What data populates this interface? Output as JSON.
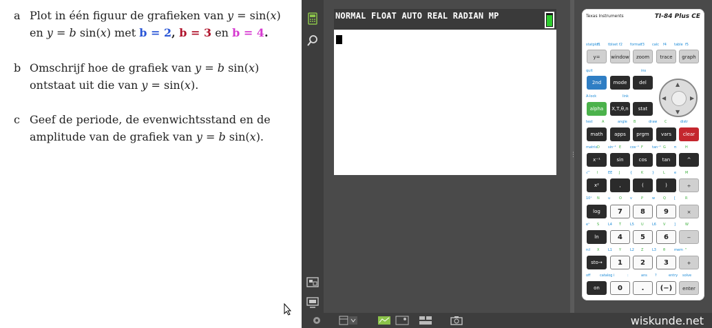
{
  "questions": [
    {
      "letter": "a",
      "line1_pre": "Plot in één figuur de grafieken van ",
      "line1_math": "y",
      "line1_mid": " = sin(",
      "line1_x": "x",
      "line1_end": ")",
      "line2_pre": "en ",
      "line2_math": "y",
      "line2_mid": " = ",
      "line2_b": "b",
      "line2_sin": " sin(",
      "line2_x": "x",
      "line2_end": ") met ",
      "b2": "b = 2",
      "b3": "b = 3",
      "sep": ", ",
      "en": " en ",
      "b4": "b = 4",
      "dot": "."
    },
    {
      "letter": "b",
      "line1_pre": "Omschrijf hoe de grafiek van ",
      "line1_math": "y",
      "line1_mid": " = ",
      "line1_b": "b",
      "line1_sin": " sin(",
      "line1_x": "x",
      "line1_end": ")",
      "line2_pre": "ontstaat uit die van ",
      "line2_math": "y",
      "line2_mid": " = sin(",
      "line2_x": "x",
      "line2_end": ")."
    },
    {
      "letter": "c",
      "line1": "Geef de periode, de evenwichtsstand en de",
      "line2_pre": "amplitude van de grafiek van ",
      "line2_math": "y",
      "line2_mid": " = ",
      "line2_b": "b",
      "line2_sin": " sin(",
      "line2_x": "x",
      "line2_end": ")."
    }
  ],
  "screen": {
    "status": "NORMAL FLOAT AUTO REAL RADIAN MP"
  },
  "calculator": {
    "brand": "Texas Instruments",
    "model": "TI-84 Plus CE",
    "row1_labels": [
      "statplot",
      "f1",
      "tblset",
      "f2",
      "format",
      "f3",
      "calc",
      "f4",
      "table",
      "f5"
    ],
    "row1_keys": [
      "y=",
      "window",
      "zoom",
      "trace",
      "graph"
    ],
    "row2_labels": [
      "quit",
      "ins"
    ],
    "row2_keys": [
      "2nd",
      "mode",
      "del"
    ],
    "row3_labels": [
      "A-lock",
      "link",
      "list"
    ],
    "row3_keys": [
      "alpha",
      "X,T,θ,n",
      "stat"
    ],
    "row4_labels": [
      "test",
      "A",
      "angle",
      "B",
      "draw",
      "C",
      "distr"
    ],
    "row4_keys": [
      "math",
      "apps",
      "prgm",
      "vars",
      "clear"
    ],
    "row5_labels": [
      "matrix",
      "D",
      "sin⁻¹",
      "E",
      "cos⁻¹",
      "F",
      "tan⁻¹",
      "G",
      "π",
      "H"
    ],
    "row5_keys": [
      "x⁻¹",
      "sin",
      "cos",
      "tan",
      "^"
    ],
    "row6_labels": [
      "√‾",
      "I",
      "EE",
      "J",
      "{",
      "K",
      "}",
      "L",
      "e",
      "M"
    ],
    "row6_keys": [
      "x²",
      ",",
      "(",
      ")",
      "÷"
    ],
    "row7_labels": [
      "10ˣ",
      "N",
      "u",
      "O",
      "v",
      "P",
      "w",
      "Q",
      "[",
      "R"
    ],
    "row7_keys": [
      "log",
      "7",
      "8",
      "9",
      "×"
    ],
    "row8_labels": [
      "eˣ",
      "S",
      "L4",
      "T",
      "L5",
      "U",
      "L6",
      "V",
      "]",
      "W"
    ],
    "row8_keys": [
      "ln",
      "4",
      "5",
      "6",
      "−"
    ],
    "row9_labels": [
      "rcl",
      "X",
      "L1",
      "Y",
      "L2",
      "Z",
      "L3",
      "θ",
      "mem",
      "\""
    ],
    "row9_keys": [
      "sto→",
      "1",
      "2",
      "3",
      "+"
    ],
    "row10_labels": [
      "off",
      "catalog",
      "i",
      ":",
      "ans",
      "?",
      "entry",
      "solve"
    ],
    "row10_keys": [
      "on",
      "0",
      ".",
      "(−)",
      "enter"
    ]
  },
  "watermark": "wiskunde.net"
}
